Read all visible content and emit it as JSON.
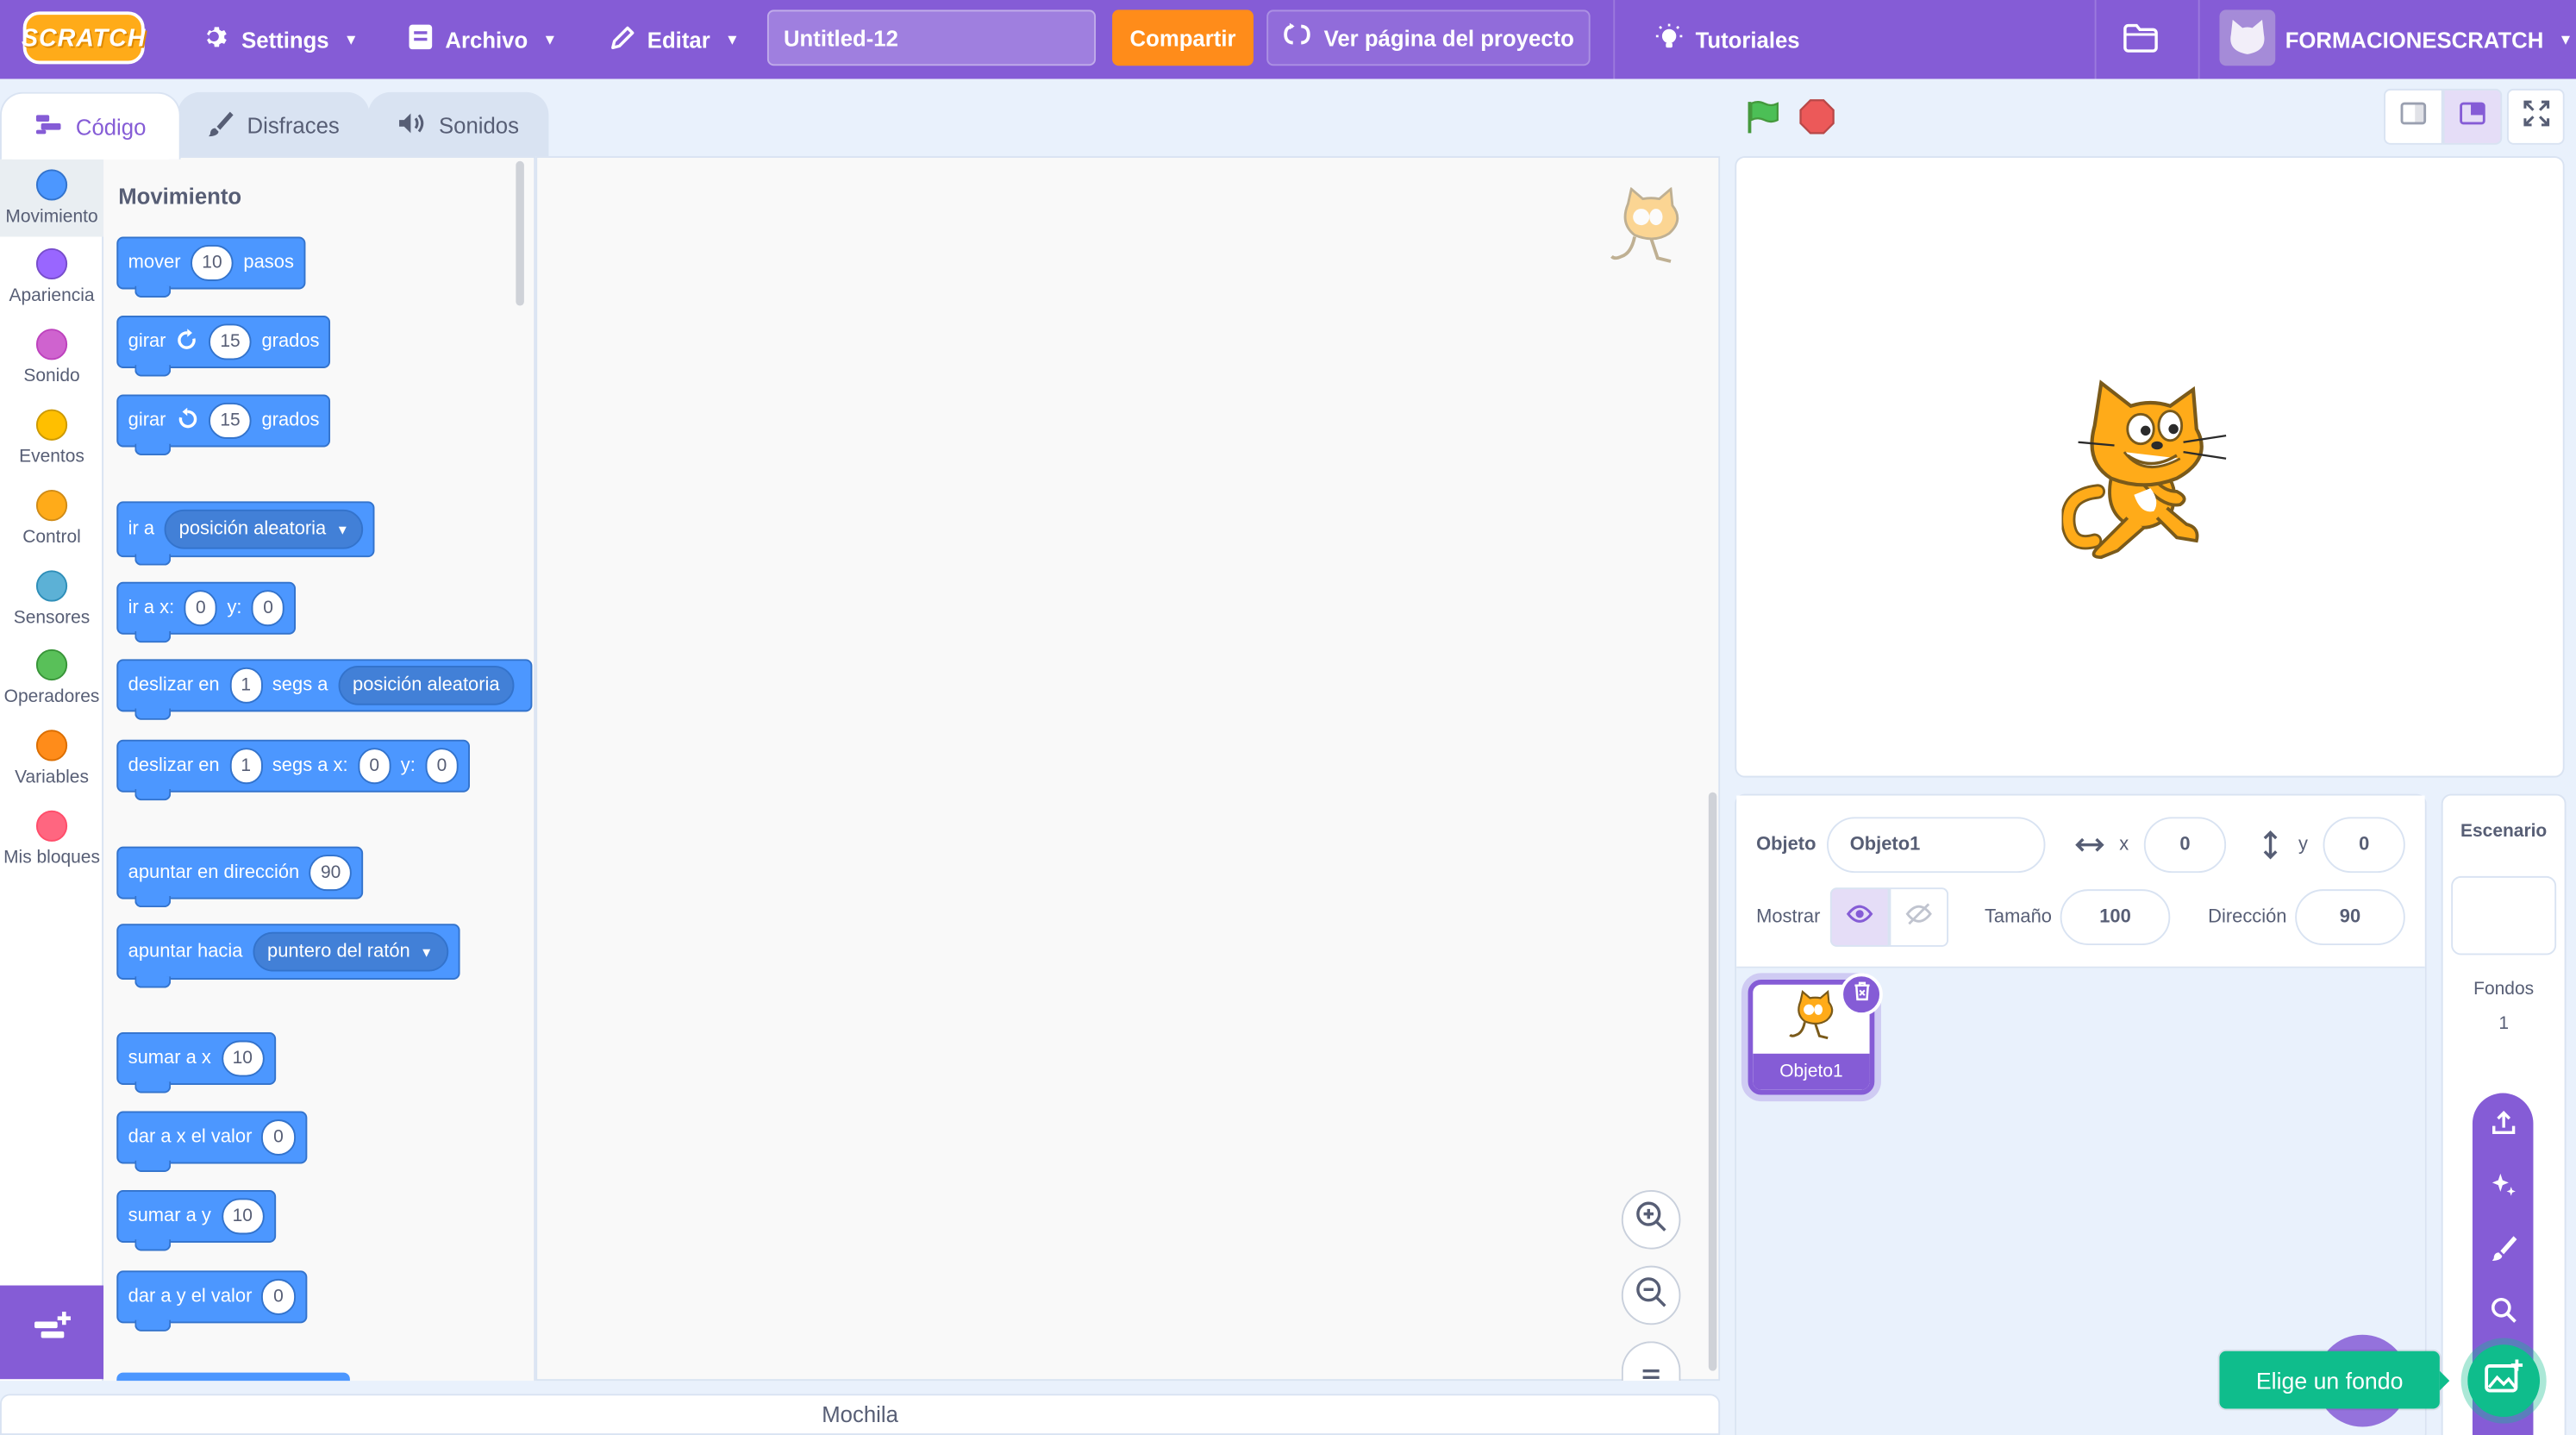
{
  "menubar": {
    "logo": "SCRATCH",
    "settings": "Settings",
    "file": "Archivo",
    "edit": "Editar",
    "project_title": "Untitled-12",
    "share": "Compartir",
    "see_project_page": "Ver página del proyecto",
    "tutorials": "Tutoriales",
    "username": "FORMACIONESCRATCH"
  },
  "tabs": {
    "code": "Código",
    "costumes": "Disfraces",
    "sounds": "Sonidos"
  },
  "categories": [
    {
      "label": "Movimiento",
      "color": "#4c97ff"
    },
    {
      "label": "Apariencia",
      "color": "#9966ff"
    },
    {
      "label": "Sonido",
      "color": "#cf63cf"
    },
    {
      "label": "Eventos",
      "color": "#ffbf00"
    },
    {
      "label": "Control",
      "color": "#ffab19"
    },
    {
      "label": "Sensores",
      "color": "#5cb1d6"
    },
    {
      "label": "Operadores",
      "color": "#59c059"
    },
    {
      "label": "Variables",
      "color": "#ff8c1a"
    },
    {
      "label": "Mis bloques",
      "color": "#ff6680"
    }
  ],
  "palette": {
    "section": "Movimiento",
    "move": {
      "a": "mover",
      "n": "10",
      "b": "pasos"
    },
    "turn_right": {
      "a": "girar",
      "n": "15",
      "b": "grados"
    },
    "turn_left": {
      "a": "girar",
      "n": "15",
      "b": "grados"
    },
    "goto": {
      "a": "ir a",
      "drop": "posición aleatoria"
    },
    "goto_xy": {
      "a": "ir a x:",
      "x": "0",
      "b": "y:",
      "y": "0"
    },
    "glide": {
      "a": "deslizar en",
      "n": "1",
      "b": "segs a",
      "drop": "posición aleatoria"
    },
    "glide_xy": {
      "a": "deslizar en",
      "n": "1",
      "b": "segs a x:",
      "x": "0",
      "c": "y:",
      "y": "0"
    },
    "point_dir": {
      "a": "apuntar en dirección",
      "n": "90"
    },
    "point_towards": {
      "a": "apuntar hacia",
      "drop": "puntero del ratón"
    },
    "change_x": {
      "a": "sumar a x",
      "n": "10"
    },
    "set_x": {
      "a": "dar a x el valor",
      "n": "0"
    },
    "change_y": {
      "a": "sumar a y",
      "n": "10"
    },
    "set_y": {
      "a": "dar a y el valor",
      "n": "0"
    }
  },
  "backpack": "Mochila",
  "sprite_info": {
    "sprite_label": "Objeto",
    "sprite_name": "Objeto1",
    "x_label": "x",
    "x": "0",
    "y_label": "y",
    "y": "0",
    "show_label": "Mostrar",
    "size_label": "Tamaño",
    "size": "100",
    "direction_label": "Dirección",
    "direction": "90"
  },
  "sprites": [
    {
      "name": "Objeto1"
    }
  ],
  "stage_panel": {
    "title": "Escenario",
    "backdrops_label": "Fondos",
    "backdrops_count": "1"
  },
  "tooltip": "Elige un fondo",
  "colors": {
    "accent": "#855cd6",
    "motion": "#4c97ff",
    "share": "#ff8c1a",
    "backdrop": "#0fbd8c"
  }
}
